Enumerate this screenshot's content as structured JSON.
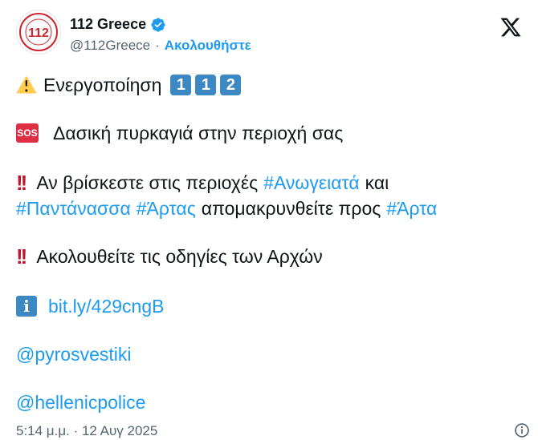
{
  "account": {
    "name": "112 Greece",
    "handle": "@112Greece",
    "separator": "·",
    "follow_label": "Ακολουθήστε",
    "avatar_text": "112"
  },
  "tweet": {
    "line1": {
      "text": "Ενεργοποίηση",
      "keycaps": [
        "1",
        "1",
        "2"
      ]
    },
    "line2": {
      "badge": "SOS",
      "text": "Δασική πυρκαγιά στην περιοχή σας"
    },
    "line3": {
      "marks": "!!",
      "text_a": "Αν βρίσκεστε στις περιοχές",
      "tag_a": "#Ανωγειατά",
      "text_b": "και"
    },
    "line4": {
      "tag_b": "#Παντάνασσα",
      "tag_c": "#Άρτας",
      "text_c": "απομακρυνθείτε προς",
      "tag_d": "#Άρτα"
    },
    "line5": {
      "marks": "!!",
      "text": "Ακολουθείτε τις οδηγίες των Αρχών"
    },
    "line6": {
      "info": "i",
      "link": "bit.ly/429cngB"
    },
    "mention1": "@pyrosvestiki",
    "mention2": "@hellenicpolice"
  },
  "timestamp": "5:14 μ.μ. · 12 Αυγ 2025",
  "colors": {
    "link": "#1d9bf0",
    "muted": "#536471",
    "keycap": "#3b88c3",
    "sos": "#dd2e44"
  }
}
